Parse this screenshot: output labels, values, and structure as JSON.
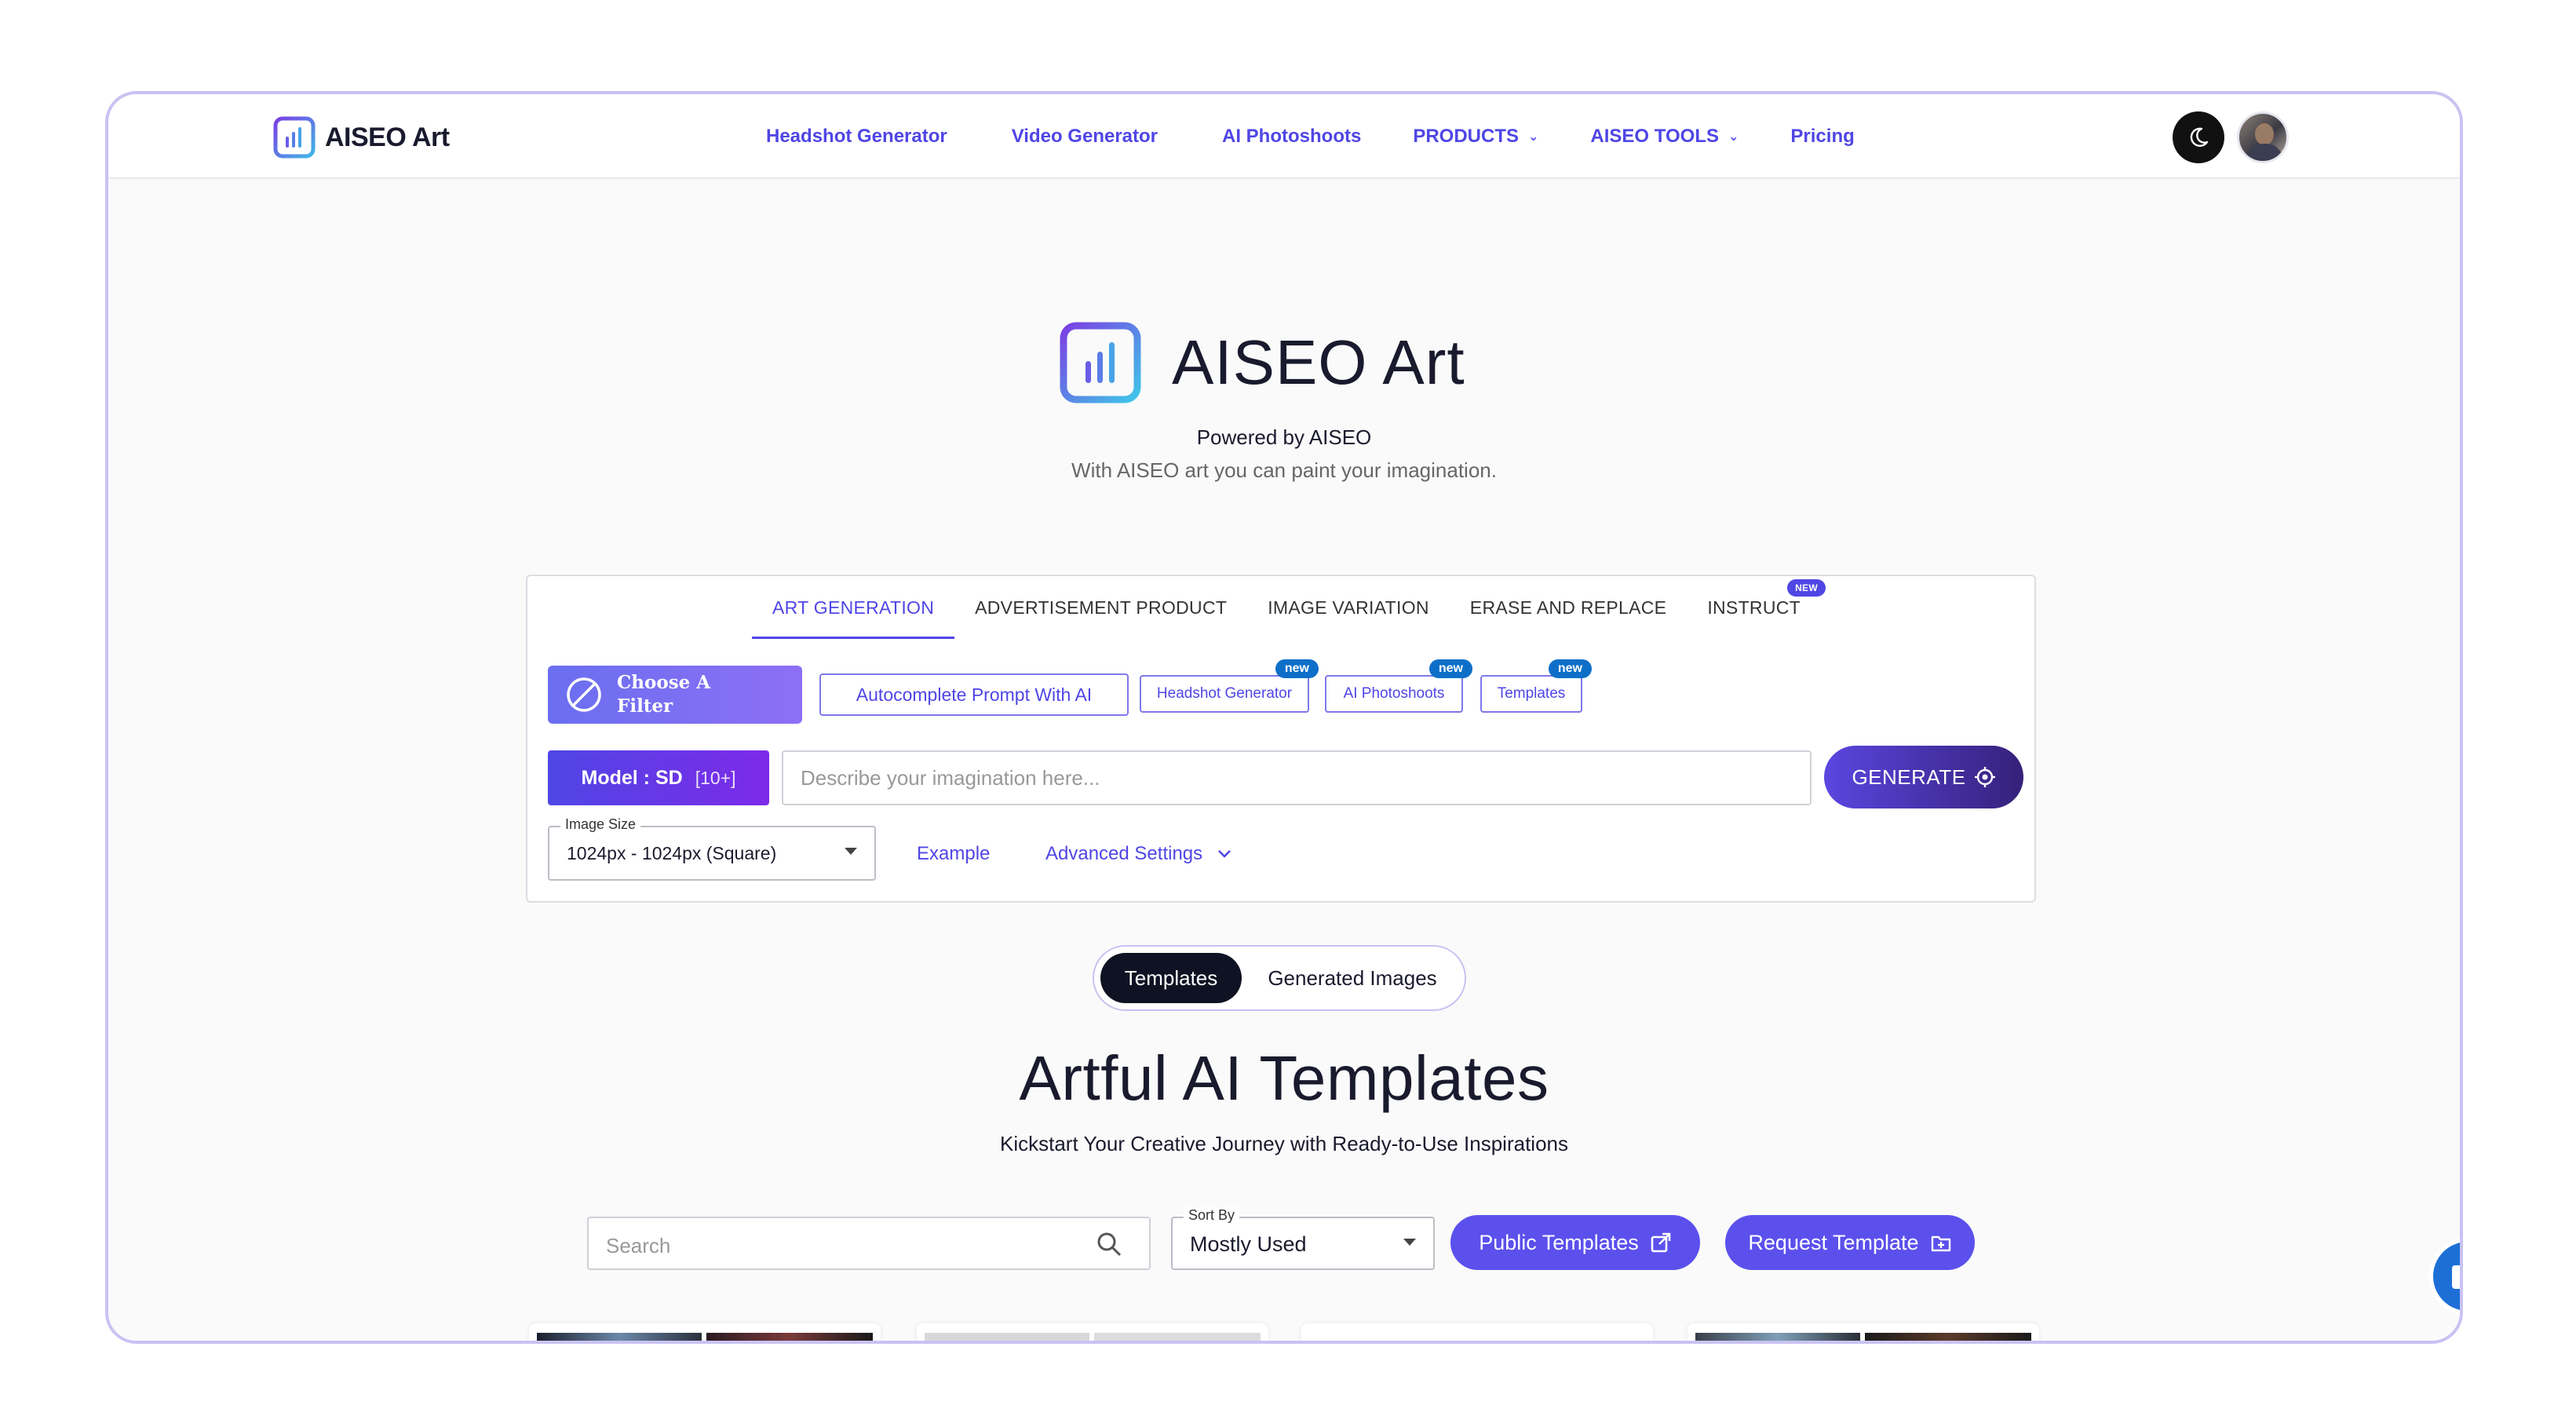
{
  "nav": {
    "brand": "AISEO Art",
    "links": [
      {
        "label": "Headshot Generator"
      },
      {
        "label": "Video Generator"
      },
      {
        "label": "AI Photoshoots"
      },
      {
        "label": "PRODUCTS",
        "dropdown": true
      },
      {
        "label": "AISEO TOOLS",
        "dropdown": true
      },
      {
        "label": "Pricing"
      }
    ],
    "theme_icon": "moon-icon",
    "avatar": "user-avatar"
  },
  "hero": {
    "title": "AISEO Art",
    "powered": "Powered by AISEO",
    "tagline": "With AISEO art you can paint your imagination."
  },
  "generator": {
    "tabs": [
      {
        "label": "ART GENERATION",
        "active": true
      },
      {
        "label": "ADVERTISEMENT PRODUCT"
      },
      {
        "label": "IMAGE VARIATION"
      },
      {
        "label": "ERASE AND REPLACE"
      },
      {
        "label": "INSTRUCT",
        "badge": "NEW"
      }
    ],
    "filter_label": "Choose A Filter",
    "autocomplete_label": "Autocomplete Prompt With AI",
    "mini_buttons": [
      {
        "label": "Headshot Generator",
        "badge": "new"
      },
      {
        "label": "AI Photoshoots",
        "badge": "new"
      },
      {
        "label": "Templates",
        "badge": "new"
      }
    ],
    "model_label": "Model : SD",
    "model_count": "[10+]",
    "prompt_placeholder": "Describe your imagination here...",
    "generate_label": "GENERATE",
    "image_size_legend": "Image Size",
    "image_size_value": "1024px - 1024px (Square)",
    "example_label": "Example",
    "advanced_label": "Advanced Settings"
  },
  "toggle": {
    "options": [
      {
        "label": "Templates",
        "selected": true
      },
      {
        "label": "Generated Images"
      }
    ]
  },
  "templates_section": {
    "title": "Artful AI Templates",
    "subtitle": "Kickstart Your Creative Journey with Ready-to-Use Inspirations",
    "search_placeholder": "Search",
    "sort_legend": "Sort By",
    "sort_value": "Mostly Used",
    "public_label": "Public Templates",
    "request_label": "Request Template"
  },
  "colors": {
    "accent": "#4f46e5",
    "frame_border": "#c9c2f2",
    "new_badge": "#0e6fc9"
  }
}
